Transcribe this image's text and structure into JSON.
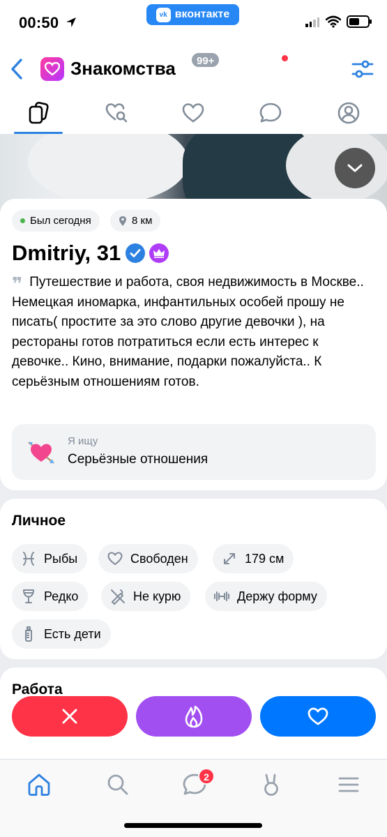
{
  "status_bar": {
    "time": "00:50",
    "vk_label": "вконтакте",
    "vk_logo": "vk"
  },
  "header": {
    "title": "Знакомства"
  },
  "tabs": {
    "likes_badge": "99+"
  },
  "profile": {
    "online_status": "Был сегодня",
    "distance": "8 км",
    "name": "Dmitriy, 31",
    "quote_mark": "❞",
    "about": "Путешествие и работа, своя недвижимость в Москве.. Немецкая иномарка, инфантильных особей прошу не писать( простите за это слово другие девочки ), на рестораны готов потратиться если есть интерес к девочке.. Кино, внимание, подарки пожалуйста.. К серьёзным отношениям готов.",
    "looking_for_caption": "Я ищу",
    "looking_for_value": "Серьёзные отношения"
  },
  "personal": {
    "title": "Личное",
    "chips": [
      {
        "icon": "pisces-icon",
        "label": "Рыбы"
      },
      {
        "icon": "heart-outline-icon",
        "label": "Свободен"
      },
      {
        "icon": "height-icon",
        "label": "179 см"
      },
      {
        "icon": "glass-icon",
        "label": "Редко"
      },
      {
        "icon": "no-smoking-icon",
        "label": "Не курю"
      },
      {
        "icon": "dumbbell-icon",
        "label": "Держу форму"
      },
      {
        "icon": "baby-bottle-icon",
        "label": "Есть дети"
      }
    ]
  },
  "work": {
    "title": "Работа"
  },
  "bottom_nav": {
    "messages_badge": "2"
  },
  "colors": {
    "accent": "#2d81e0",
    "dislike": "#ff3347",
    "superlike": "#a24ff1",
    "like": "#0077ff",
    "online": "#4bb34b"
  }
}
